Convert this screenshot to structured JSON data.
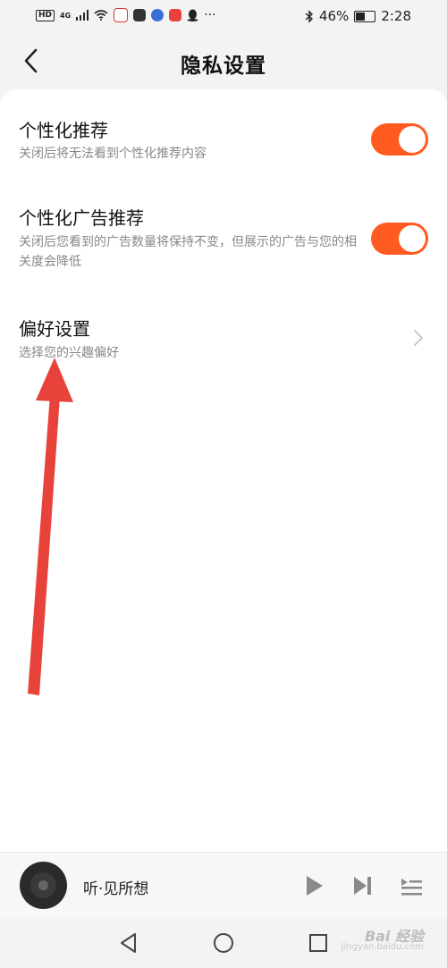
{
  "status_bar": {
    "network_badge": "HD",
    "network_type": "4G",
    "battery_percent": "46%",
    "battery_level": 0.46,
    "time": "2:28",
    "dots": "···"
  },
  "header": {
    "title": "隐私设置",
    "back_icon": "chevron-left-icon"
  },
  "settings": [
    {
      "title": "个性化推荐",
      "subtitle": "关闭后将无法看到个性化推荐内容",
      "control": "toggle",
      "enabled": true
    },
    {
      "title": "个性化广告推荐",
      "subtitle": "关闭后您看到的广告数量将保持不变，但展示的广告与您的相关度会降低",
      "control": "toggle",
      "enabled": true
    },
    {
      "title": "偏好设置",
      "subtitle": "选择您的兴趣偏好",
      "control": "chevron"
    }
  ],
  "player": {
    "track_title": "听·见所想",
    "icons": [
      "play-icon",
      "next-icon",
      "playlist-icon"
    ]
  },
  "colors": {
    "accent": "#ff5a1f",
    "annotation_arrow": "#e8433a"
  },
  "watermark": {
    "text": "Bai 经验",
    "sub": "jingyan.baidu.com"
  }
}
